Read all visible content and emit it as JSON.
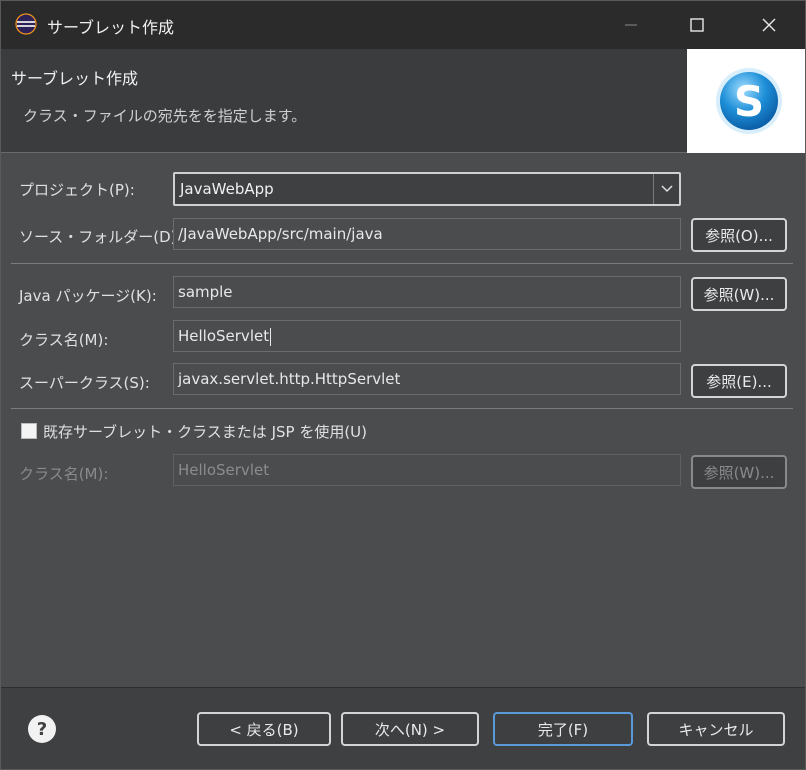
{
  "window": {
    "title": "サーブレット作成"
  },
  "header": {
    "title": "サーブレット作成",
    "description": "クラス・ファイルの宛先をを指定します。"
  },
  "form": {
    "project": {
      "label": "プロジェクト(P):",
      "value": "JavaWebApp"
    },
    "source_folder": {
      "label": "ソース・フォルダー(D):",
      "value": "/JavaWebApp/src/main/java",
      "browse": "参照(O)..."
    },
    "package": {
      "label": "Java パッケージ(K):",
      "value": "sample",
      "browse": "参照(W)..."
    },
    "class_name": {
      "label": "クラス名(M):",
      "value": "HelloServlet"
    },
    "superclass": {
      "label": "スーパークラス(S):",
      "value": "javax.servlet.http.HttpServlet",
      "browse": "参照(E)..."
    },
    "use_existing": {
      "label": "既存サーブレット・クラスまたは JSP を使用(U)",
      "checked": false
    },
    "existing_class": {
      "label": "クラス名(M):",
      "value": "HelloServlet",
      "browse": "参照(W)..."
    }
  },
  "footer": {
    "back": "< 戻る(B)",
    "next": "次へ(N) >",
    "finish": "完了(F)",
    "cancel": "キャンセル"
  },
  "icons": {
    "app": "eclipse-icon",
    "logo": "servlet-s-logo",
    "help": "help-icon"
  },
  "colors": {
    "window_bg": "#4a4c4e",
    "titlebar_bg": "#2b2b2b",
    "logo_blue": "#1e8fd8"
  }
}
